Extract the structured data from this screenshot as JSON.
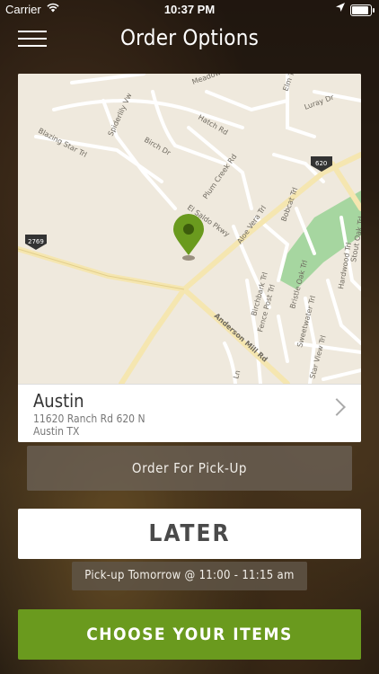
{
  "status_bar": {
    "carrier": "Carrier",
    "wifi_icon": "wifi-icon",
    "time": "10:37 PM",
    "location_icon": "location-arrow-icon",
    "battery_icon": "battery-icon"
  },
  "nav": {
    "title": "Order Options",
    "menu_icon": "hamburger-menu-icon"
  },
  "map": {
    "pin_icon": "map-pin-icon",
    "pin_color": "#6a9a1e",
    "street_labels": [
      "Meadow Lark",
      "Hatch Rd",
      "Spiderlily Vw",
      "Blazing Star Trl",
      "Birch Dr",
      "Plum Creek Rd",
      "El Saldo Pkwy",
      "Aloe Vera Trl",
      "Bobcat Trl",
      "Luray Dr",
      "Elm Trl",
      "Anderson Mill Rd",
      "Birchbark Trl",
      "Fence Post Trl",
      "Bristle Oak Trl",
      "Sweetwater Trl",
      "Star View Trl",
      "Hardwood Trl",
      "Stout Oak Trl",
      "Ln"
    ],
    "highway_shields": [
      "2769",
      "620"
    ]
  },
  "store": {
    "name": "Austin",
    "address_line1": "11620 Ranch Rd 620 N",
    "address_line2": "Austin TX",
    "chevron_icon": "chevron-right-icon"
  },
  "order_type": {
    "label": "Order For Pick-Up"
  },
  "timing": {
    "label": "LATER",
    "pickup_info": "Pick-up Tomorrow @ 11:00 - 11:15 am"
  },
  "cta": {
    "label": "CHOOSE YOUR ITEMS"
  },
  "colors": {
    "accent": "#6a9a1e",
    "map_bg": "#efe9dd"
  }
}
